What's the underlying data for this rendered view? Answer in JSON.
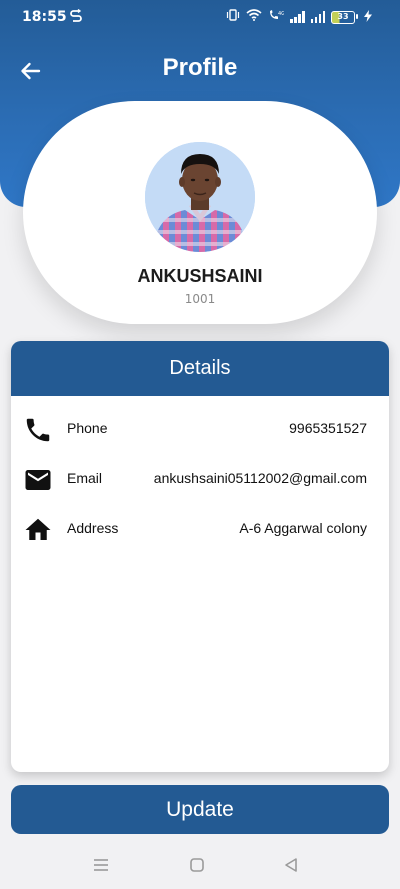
{
  "status_bar": {
    "time": "18:55",
    "sync_icon": "sync-icon",
    "battery_level": "33",
    "icons": [
      "vibrate-icon",
      "wifi-icon",
      "volte-call-icon",
      "signal-icon",
      "signal-icon",
      "battery-icon",
      "charging-icon"
    ]
  },
  "header": {
    "title": "Profile",
    "back_icon": "arrow-left-icon",
    "color": "#2b6cb3"
  },
  "profile": {
    "name": "ANKUSHSAINI",
    "id": "1001",
    "avatar": "avatar-photo"
  },
  "details": {
    "title": "Details",
    "header_color": "#235a93",
    "rows": [
      {
        "icon": "phone-icon",
        "label": "Phone",
        "value": "9965351527"
      },
      {
        "icon": "email-icon",
        "label": "Email",
        "value": "ankushsaini05112002@gmail.com"
      },
      {
        "icon": "home-icon",
        "label": "Address",
        "value": "A-6 Aggarwal colony"
      }
    ]
  },
  "actions": {
    "update_label": "Update",
    "button_color": "#235a93"
  },
  "nav": {
    "icons": [
      "menu-icon",
      "home-square-icon",
      "back-triangle-icon"
    ]
  }
}
